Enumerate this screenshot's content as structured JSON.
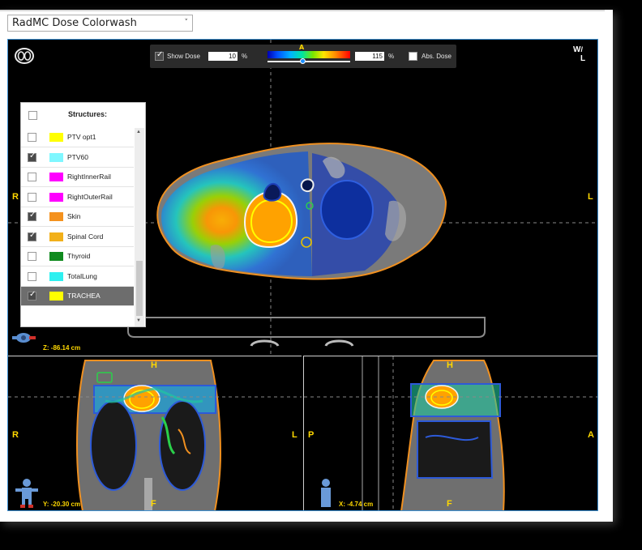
{
  "window": {
    "view_selector": {
      "value": "RadMC Dose Colorwash"
    }
  },
  "dose_toolbar": {
    "show_dose_label": "Show Dose",
    "show_dose_checked": true,
    "min_value": "10",
    "max_value": "115",
    "unit": "%",
    "scale_marker": "A",
    "abs_dose_label": "Abs. Dose",
    "abs_dose_checked": false
  },
  "structures": {
    "header": "Structures:",
    "items": [
      {
        "name": "PTV opt1",
        "color": "#ffff00",
        "checked": false,
        "selected": false
      },
      {
        "name": "PTV60",
        "color": "#7ff7ff",
        "checked": true,
        "selected": false
      },
      {
        "name": "RightInnerRail",
        "color": "#ff00ff",
        "checked": false,
        "selected": false
      },
      {
        "name": "RightOuterRail",
        "color": "#ff00ff",
        "checked": false,
        "selected": false
      },
      {
        "name": "Skin",
        "color": "#f4921e",
        "checked": true,
        "selected": false
      },
      {
        "name": "Spinal Cord",
        "color": "#f2b01a",
        "checked": true,
        "selected": false
      },
      {
        "name": "Thyroid",
        "color": "#0f8a1e",
        "checked": false,
        "selected": false
      },
      {
        "name": "TotalLung",
        "color": "#2ef0f0",
        "checked": false,
        "selected": false
      },
      {
        "name": "TRACHEA",
        "color": "#ffff00",
        "checked": true,
        "selected": true
      }
    ]
  },
  "axial": {
    "left": "R",
    "right": "L",
    "z_readout": "Z: -86.14 cm",
    "wl_top": "W",
    "wl_bottom": "L"
  },
  "coronal": {
    "top": "H",
    "bottom": "F",
    "left": "R",
    "right": "L",
    "y_readout": "Y: -20.30 cm"
  },
  "sagittal": {
    "top": "H",
    "bottom": "F",
    "left": "P",
    "right": "A",
    "x_readout": "X: -4.74 cm"
  },
  "icons": [
    "body-outline-icon",
    "patient-orientation-icon",
    "window-level-icon",
    "dropdown-chevron-icon"
  ]
}
